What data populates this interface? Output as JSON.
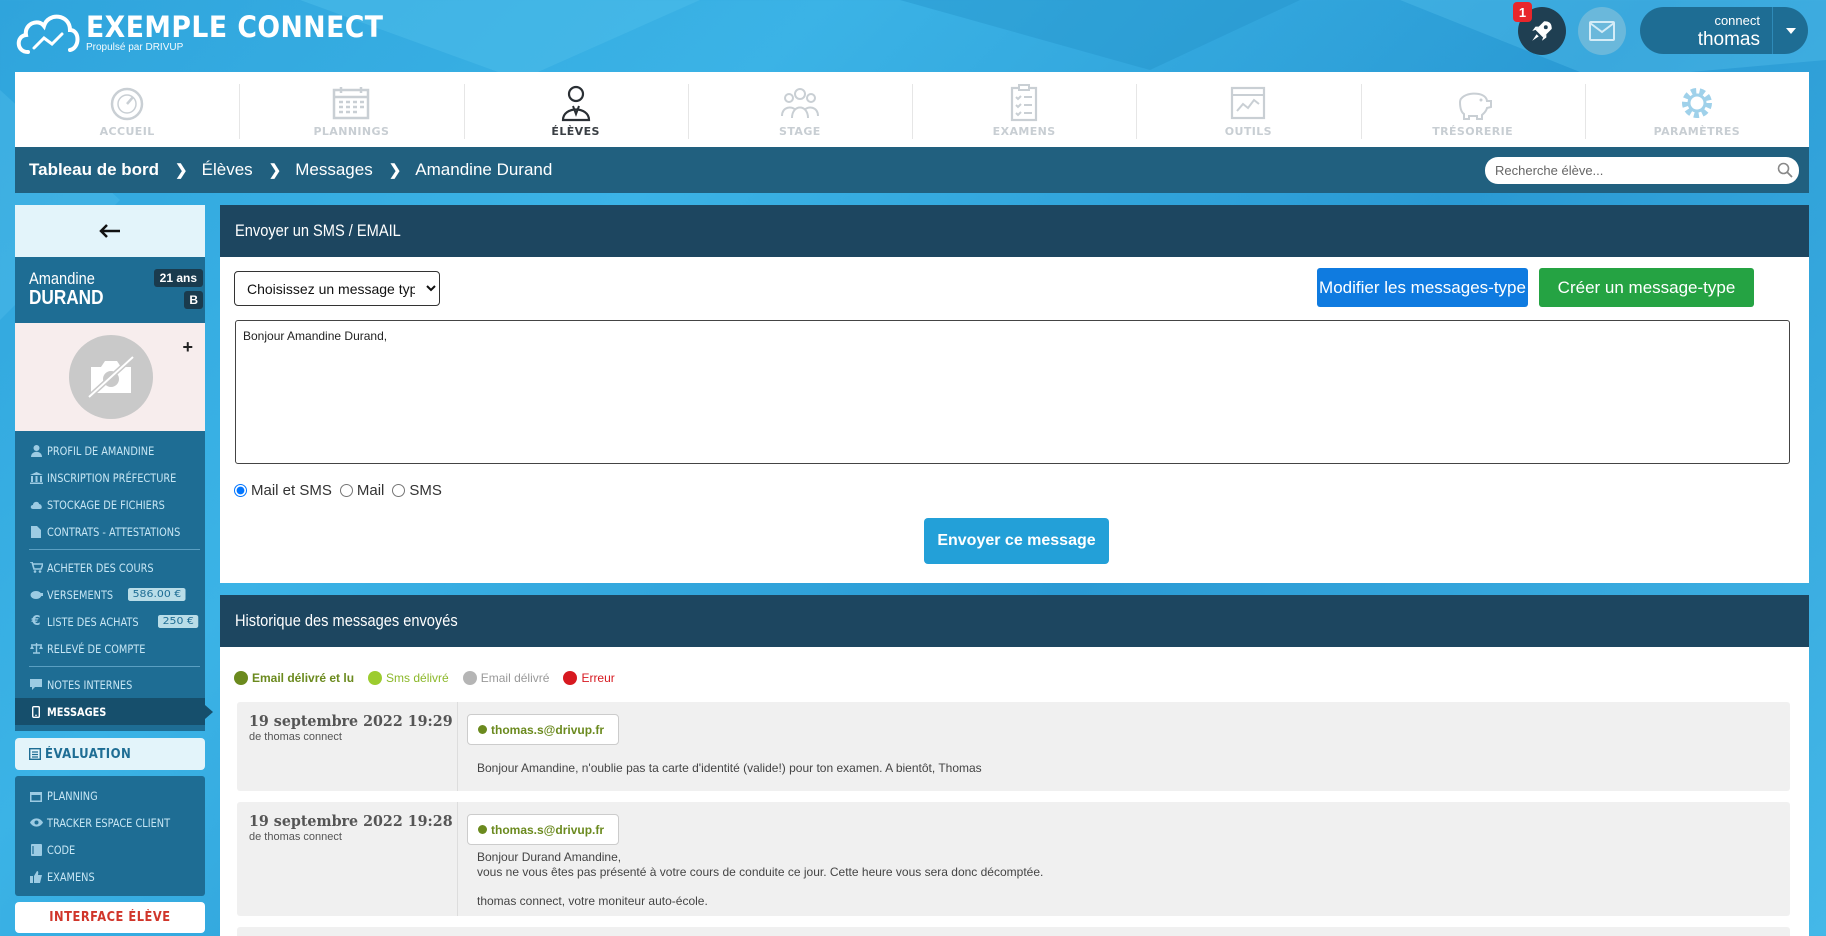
{
  "app": {
    "title": "EXEMPLE CONNECT",
    "subtitle": "Propulsé par DRIVUP"
  },
  "header": {
    "notif_count": "1",
    "user_label": "connect",
    "user_name": "thomas"
  },
  "nav": [
    {
      "label": "ACCUEIL",
      "icon": "speedometer-icon"
    },
    {
      "label": "PLANNINGS",
      "icon": "calendar-icon"
    },
    {
      "label": "ÉLÈVES",
      "icon": "student-icon",
      "active": true
    },
    {
      "label": "STAGE",
      "icon": "group-icon"
    },
    {
      "label": "EXAMENS",
      "icon": "checklist-icon"
    },
    {
      "label": "OUTILS",
      "icon": "tools-window-icon"
    },
    {
      "label": "TRÉSORERIE",
      "icon": "piggy-bank-icon"
    },
    {
      "label": "PARAMÈTRES",
      "icon": "gear-icon"
    }
  ],
  "breadcrumb": [
    "Tableau de bord",
    "Élèves",
    "Messages",
    "Amandine Durand"
  ],
  "search": {
    "placeholder": "Recherche élève..."
  },
  "student": {
    "first_name": "Amandine",
    "last_name": "DURAND",
    "age": "21 ans",
    "permit": "B"
  },
  "sidebar": {
    "group1": [
      {
        "label": "PROFIL DE AMANDINE",
        "icon": "user-icon"
      },
      {
        "label": "INSCRIPTION PRÉFECTURE",
        "icon": "bank-icon"
      },
      {
        "label": "STOCKAGE DE FICHIERS",
        "icon": "cloud-icon"
      },
      {
        "label": "CONTRATS - ATTESTATIONS",
        "icon": "file-icon"
      }
    ],
    "group2": [
      {
        "label": "ACHETER DES COURS",
        "icon": "cart-icon"
      },
      {
        "label": "VERSEMENTS",
        "icon": "piggy-icon",
        "badge": "586.00 €"
      },
      {
        "label": "LISTE DES ACHATS",
        "icon": "euro-icon",
        "badge": "250 €"
      },
      {
        "label": "RELEVÉ DE COMPTE",
        "icon": "scale-icon"
      }
    ],
    "group3": [
      {
        "label": "NOTES INTERNES",
        "icon": "comment-icon"
      },
      {
        "label": "MESSAGES",
        "icon": "mobile-icon",
        "active": true
      }
    ],
    "evaluation": "ÉVALUATION",
    "group4": [
      {
        "label": "PLANNING",
        "icon": "calendar-small-icon"
      },
      {
        "label": "TRACKER ESPACE CLIENT",
        "icon": "eye-icon"
      },
      {
        "label": "CODE",
        "icon": "book-icon"
      },
      {
        "label": "EXAMENS",
        "icon": "thumbs-up-icon"
      }
    ],
    "interface_button": "INTERFACE ÉLÈVE"
  },
  "send_panel": {
    "title": "Envoyer un SMS / EMAIL",
    "select_value": "Choisissez un message type",
    "modify_button": "Modifier les messages-type",
    "create_button": "Créer un message-type",
    "message": "Bonjour Amandine Durand,",
    "radio_options": [
      "Mail et SMS",
      "Mail",
      "SMS"
    ],
    "radio_selected": "Mail et SMS",
    "send_button": "Envoyer ce message"
  },
  "history_panel": {
    "title": "Historique des messages envoyés",
    "legend": [
      {
        "label": "Email délivré et lu",
        "color": "#6b8a1e"
      },
      {
        "label": "Sms délivré",
        "color": "#9ccc2f"
      },
      {
        "label": "Email délivré",
        "color": "#b5b5b5"
      },
      {
        "label": "Erreur",
        "color": "#d71920"
      }
    ],
    "messages": [
      {
        "date": "19 septembre 2022 19:29",
        "from": "de thomas connect",
        "recipient": "thomas.s@drivup.fr",
        "text": "Bonjour Amandine, n'oublie pas ta carte d'identité (valide!) pour ton examen. A bientôt, Thomas"
      },
      {
        "date": "19 septembre 2022 19:28",
        "from": "de thomas connect",
        "recipient": "thomas.s@drivup.fr",
        "text": "Bonjour Durand Amandine,\nvous ne vous êtes pas présenté à votre cours de conduite ce jour. Cette heure vous sera donc décomptée.\n\nthomas connect, votre moniteur auto-école."
      }
    ]
  },
  "colors": {
    "nav_bar": "#21607f",
    "sidebar": "#1e6d94",
    "panel_header": "#1d4660",
    "btn_blue": "#0f7be0",
    "btn_green": "#25a343",
    "send_btn": "#23a0d8"
  }
}
